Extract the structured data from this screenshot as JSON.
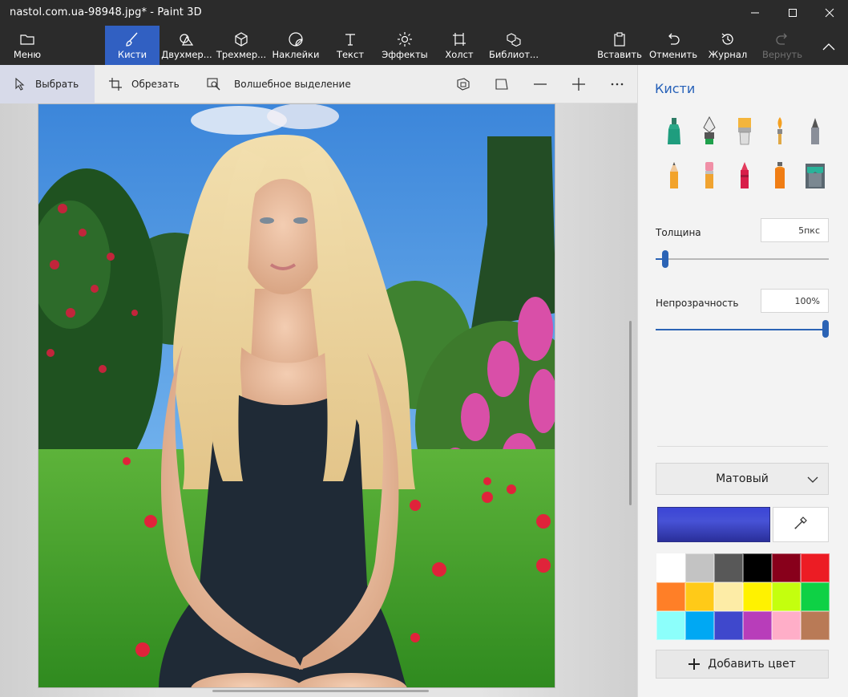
{
  "window": {
    "title": "nastol.com.ua-98948.jpg* - Paint 3D",
    "controls": [
      "minimize-icon",
      "maximize-icon",
      "close-icon"
    ]
  },
  "ribbon": {
    "menu": "Меню",
    "tools": [
      {
        "id": "brushes",
        "label": "Кисти",
        "icon": "brush-icon",
        "active": true
      },
      {
        "id": "2d",
        "label": "Двухмер...",
        "icon": "2d-shapes-icon"
      },
      {
        "id": "3d",
        "label": "Трехмер...",
        "icon": "3d-shapes-icon"
      },
      {
        "id": "stickers",
        "label": "Наклейки",
        "icon": "sticker-icon"
      },
      {
        "id": "text",
        "label": "Текст",
        "icon": "text-icon"
      },
      {
        "id": "effects",
        "label": "Эффекты",
        "icon": "effects-icon"
      },
      {
        "id": "canvas",
        "label": "Холст",
        "icon": "canvas-icon"
      },
      {
        "id": "library",
        "label": "Библиот...",
        "icon": "3d-library-icon"
      }
    ],
    "paste": "Вставить",
    "undo": "Отменить",
    "history": "Журнал",
    "redo": "Вернуть"
  },
  "toolbar": {
    "select": "Выбрать",
    "crop": "Обрезать",
    "magic_select": "Волшебное выделение"
  },
  "panel": {
    "title": "Кисти",
    "brushes": [
      "marker",
      "calligraphy-pen",
      "oil-brush",
      "watercolor",
      "pixel-pen",
      "pencil",
      "eraser",
      "crayon",
      "spray-can",
      "fill"
    ],
    "thickness_label": "Толщина",
    "thickness_value": "5пкс",
    "thickness_level": 0.03,
    "opacity_label": "Непрозрачность",
    "opacity_value": "100%",
    "opacity_level": 1.0,
    "finish": "Матовый",
    "current_color": "#4149d1",
    "palette": [
      "#ffffff",
      "#c3c3c3",
      "#585858",
      "#000000",
      "#88001b",
      "#ec1c24",
      "#ff7f27",
      "#ffca18",
      "#fdeca6",
      "#fff200",
      "#c4ff0e",
      "#0ed145",
      "#8cfffb",
      "#00a8f3",
      "#3f48cc",
      "#b83dba",
      "#ffaec8",
      "#b97a56"
    ],
    "add_color": "Добавить цвет"
  }
}
